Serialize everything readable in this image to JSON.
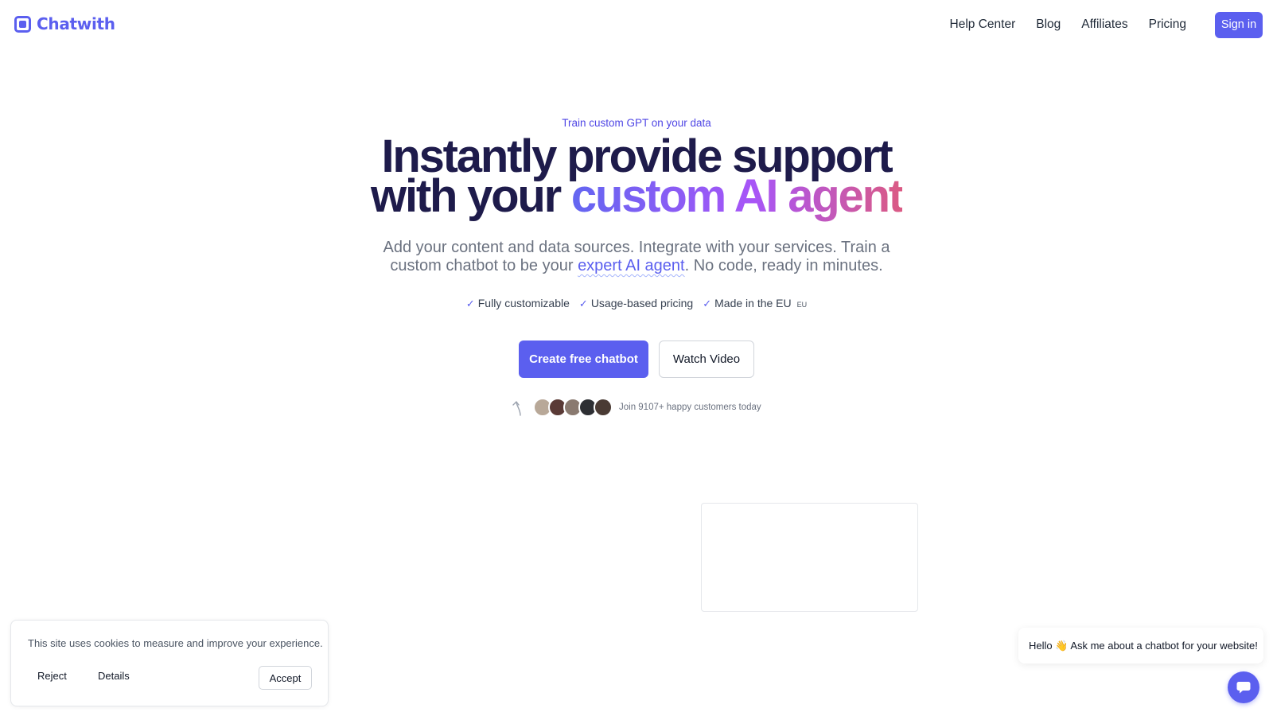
{
  "brand": {
    "name": "Chatwith",
    "accent": "#5b5fef"
  },
  "nav": {
    "items": [
      "Help Center",
      "Blog",
      "Affiliates",
      "Pricing"
    ],
    "signin": "Sign in"
  },
  "hero": {
    "eyebrow": "Train custom GPT on your data",
    "headline_line1": "Instantly provide support",
    "headline_line2_plain": "with your ",
    "headline_line2_gradient": "custom AI agent",
    "sub_part1": "Add your content and data sources. Integrate with your services. Train a custom chatbot to be your ",
    "sub_highlight": "expert AI agent",
    "sub_part2": ". No code, ready in minutes.",
    "features": [
      "Fully customizable",
      "Usage-based pricing",
      "Made in the EU"
    ],
    "eu_badge": "EU",
    "check_icon": "✓",
    "cta_primary": "Create free chatbot",
    "cta_secondary": "Watch Video",
    "social_proof": "Join 9107+ happy customers today",
    "avatar_colors": [
      "#b8a898",
      "#5a3a36",
      "#8a7a70",
      "#2d2f33",
      "#4a3b34"
    ]
  },
  "cookie": {
    "text": "This site uses cookies to measure and improve your experience.",
    "reject": "Reject",
    "details": "Details",
    "accept": "Accept"
  },
  "chat": {
    "greeting": "Hello 👋 Ask me about a chatbot for your website!"
  }
}
